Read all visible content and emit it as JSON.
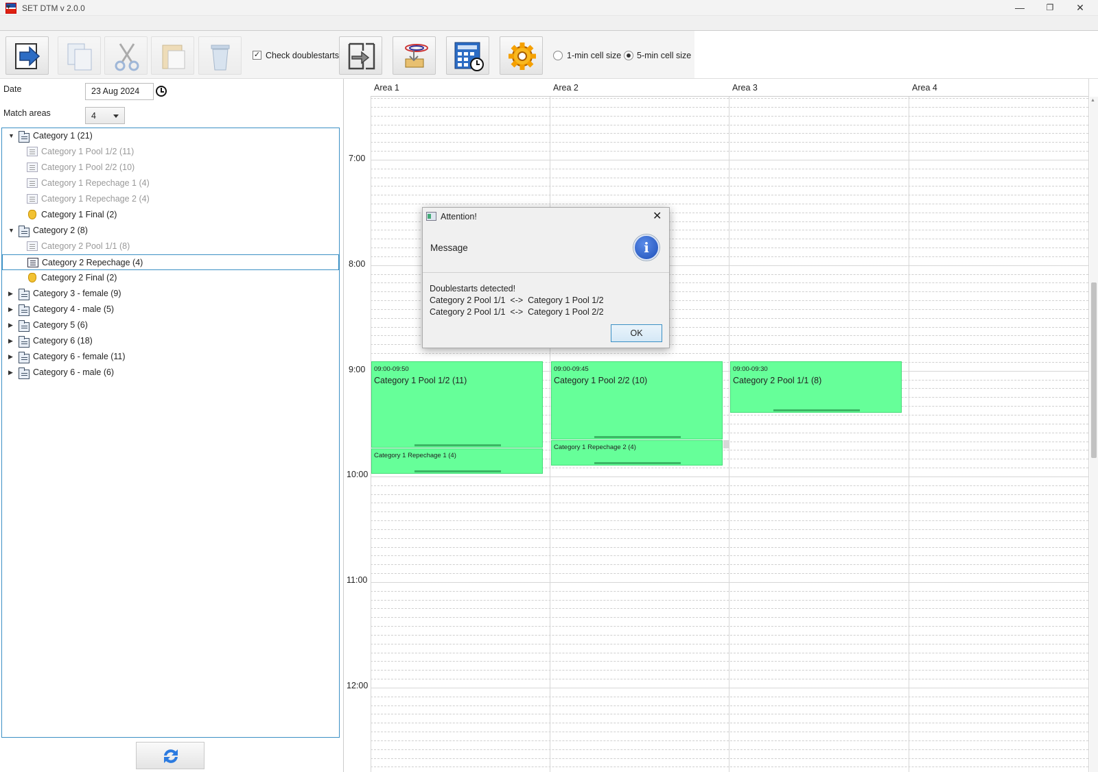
{
  "window": {
    "title": "SET DTM v 2.0.0",
    "minimize": "—",
    "restore": "❐",
    "close": "✕"
  },
  "menu": {
    "dropdown": "▼"
  },
  "toolbar": {
    "check_doublestarts_label": "Check doublestarts",
    "check_doublestarts_checked": true,
    "cell_size_1min_label": "1-min cell size",
    "cell_size_5min_label": "5-min cell size",
    "cell_size_selected": "5-min cell size",
    "icons": [
      "export-icon",
      "copy-icon",
      "cut-icon",
      "paste-icon",
      "delete-icon",
      "swap-icon",
      "upload-icon",
      "schedule-calculator-icon",
      "settings-gear-icon"
    ]
  },
  "left": {
    "date_label": "Date",
    "date_value": "23 Aug 2024",
    "areas_label": "Match areas",
    "areas_value": "4",
    "tree": [
      {
        "label": "Category 1 (21)",
        "type": "folder",
        "level": 0,
        "expanded": true
      },
      {
        "label": "Category 1 Pool 1/2 (11)",
        "type": "doc",
        "level": 1,
        "greyed": true
      },
      {
        "label": "Category 1 Pool 2/2 (10)",
        "type": "doc",
        "level": 1,
        "greyed": true
      },
      {
        "label": "Category 1 Repechage 1 (4)",
        "type": "doc",
        "level": 1,
        "greyed": true
      },
      {
        "label": "Category 1 Repechage 2 (4)",
        "type": "doc",
        "level": 1,
        "greyed": true
      },
      {
        "label": "Category 1 Final (2)",
        "type": "medal",
        "level": 1
      },
      {
        "label": "Category 2 (8)",
        "type": "folder",
        "level": 0,
        "expanded": true
      },
      {
        "label": "Category 2 Pool 1/1 (8)",
        "type": "doc",
        "level": 1,
        "greyed": true
      },
      {
        "label": "Category 2 Repechage (4)",
        "type": "doc",
        "level": 1,
        "selected": true
      },
      {
        "label": "Category 2 Final (2)",
        "type": "medal",
        "level": 1
      },
      {
        "label": "Category 3 - female (9)",
        "type": "folder",
        "level": 0
      },
      {
        "label": "Category 4 - male (5)",
        "type": "folder",
        "level": 0
      },
      {
        "label": "Category 5 (6)",
        "type": "folder",
        "level": 0
      },
      {
        "label": "Category 6 (18)",
        "type": "folder",
        "level": 0
      },
      {
        "label": "Category 6 - female (11)",
        "type": "folder",
        "level": 0
      },
      {
        "label": "Category 6 - male (6)",
        "type": "folder",
        "level": 0
      }
    ]
  },
  "schedule": {
    "areas": [
      "Area 1",
      "Area 2",
      "Area 3",
      "Area 4"
    ],
    "times": [
      "7:00",
      "8:00",
      "9:00",
      "10:00",
      "11:00",
      "12:00"
    ],
    "events": [
      {
        "time": "09:00-09:50",
        "name": "Category 1 Pool 1/2 (11)"
      },
      {
        "time": "09:00-09:45",
        "name": "Category 1 Pool 2/2 (10)"
      },
      {
        "time": "09:00-09:30",
        "name": "Category 2 Pool 1/1 (8)"
      },
      {
        "name": "Category 1 Repechage 1 (4)"
      },
      {
        "name": "Category 1 Repechage 2 (4)"
      }
    ],
    "event_color": "#66ff99"
  },
  "dialog": {
    "title": "Attention!",
    "heading": "Message",
    "info_glyph": "i",
    "lines": [
      "Doublestarts detected!",
      "Category 2 Pool 1/1  <->  Category 1 Pool 1/2",
      "Category 2 Pool 1/1  <->  Category 1 Pool 2/2"
    ],
    "ok_label": "OK",
    "close_glyph": "✕"
  }
}
